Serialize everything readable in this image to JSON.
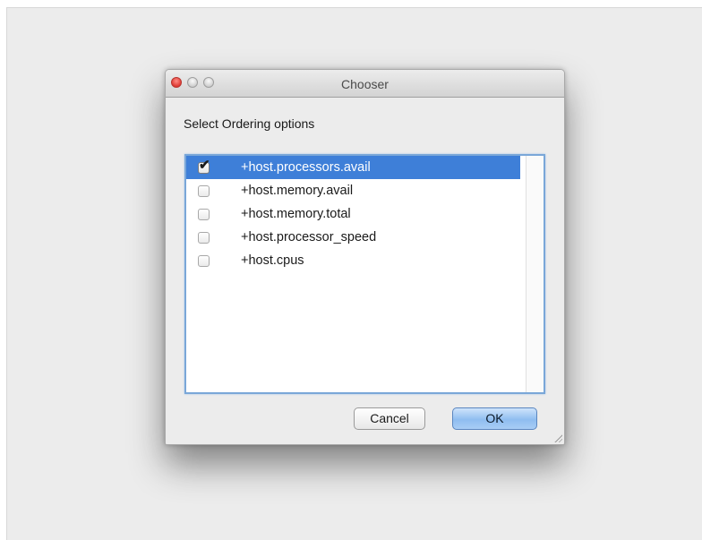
{
  "window": {
    "title": "Chooser"
  },
  "dialog": {
    "prompt": "Select Ordering options"
  },
  "options": [
    {
      "label": "+host.processors.avail",
      "checked": true,
      "selected": true
    },
    {
      "label": "+host.memory.avail",
      "checked": false,
      "selected": false
    },
    {
      "label": "+host.memory.total",
      "checked": false,
      "selected": false
    },
    {
      "label": "+host.processor_speed",
      "checked": false,
      "selected": false
    },
    {
      "label": "+host.cpus",
      "checked": false,
      "selected": false
    }
  ],
  "buttons": {
    "cancel_label": "Cancel",
    "ok_label": "OK"
  },
  "icons": {
    "close": "close-icon",
    "minimize": "minimize-icon",
    "zoom": "zoom-icon",
    "checkmark": "checkmark-icon",
    "resize": "resize-grip-icon"
  },
  "colors": {
    "selection": "#3e7fd8",
    "focus_ring": "#7aa7d8",
    "close_button": "#de3a34",
    "default_button": "#8fbdf0"
  }
}
